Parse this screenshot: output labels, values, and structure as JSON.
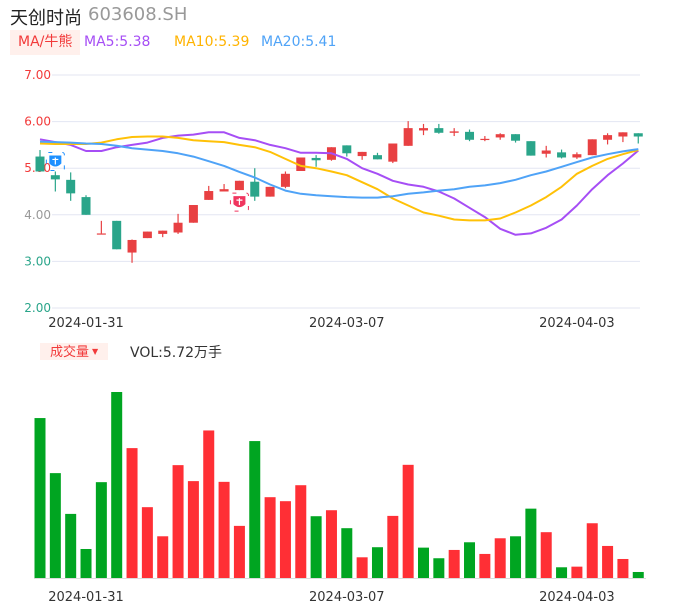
{
  "header": {
    "name": "天创时尚",
    "code": "603608.SH"
  },
  "ma_bar": {
    "toggle_label": "MA/牛熊",
    "ma5": "MA5:5.38",
    "ma10": "MA10:5.39",
    "ma20": "MA20:5.41"
  },
  "volume_bar": {
    "toggle_label": "成交量",
    "toggle_arrow": "▼",
    "vol_text": "VOL:5.72万手"
  },
  "colors": {
    "up": "#e84042",
    "down": "#2aa58a",
    "vol_up": "#ff2f35",
    "vol_down": "#00a521",
    "ma5": "#a64ef5",
    "ma10": "#ffc107",
    "ma20": "#4fa3f7",
    "grid": "#e3e6f2"
  },
  "chart_data": [
    {
      "type": "candlestick",
      "title": "天创时尚 603608.SH",
      "ylim": [
        2.0,
        7.0
      ],
      "y_ticks": [
        "7.00",
        "6.00",
        "5.00",
        "4.00",
        "3.00",
        "2.00"
      ],
      "x_ticks": [
        {
          "index": 3,
          "label": "2024-01-31"
        },
        {
          "index": 20,
          "label": "2024-03-07"
        },
        {
          "index": 35,
          "label": "2024-04-03"
        }
      ],
      "grid": true,
      "ohlc": [
        [
          5.25,
          5.39,
          4.93,
          4.93
        ],
        [
          4.85,
          4.93,
          4.5,
          4.76
        ],
        [
          4.75,
          4.91,
          4.3,
          4.46
        ],
        [
          4.38,
          4.42,
          4.0,
          4.0
        ],
        [
          3.6,
          3.87,
          3.6,
          3.6
        ],
        [
          3.87,
          3.87,
          3.26,
          3.26
        ],
        [
          3.19,
          3.47,
          2.97,
          3.46
        ],
        [
          3.5,
          3.64,
          3.5,
          3.64
        ],
        [
          3.59,
          3.66,
          3.52,
          3.66
        ],
        [
          3.62,
          4.02,
          3.59,
          3.83
        ],
        [
          3.83,
          4.21,
          3.83,
          4.21
        ],
        [
          4.32,
          4.62,
          4.32,
          4.51
        ],
        [
          4.5,
          4.66,
          4.5,
          4.55
        ],
        [
          4.53,
          4.73,
          4.53,
          4.73
        ],
        [
          4.71,
          5.0,
          4.3,
          4.39
        ],
        [
          4.39,
          4.6,
          4.39,
          4.6
        ],
        [
          4.6,
          4.93,
          4.57,
          4.88
        ],
        [
          4.94,
          5.23,
          4.94,
          5.23
        ],
        [
          5.22,
          5.28,
          5.03,
          5.17
        ],
        [
          5.18,
          5.45,
          5.16,
          5.45
        ],
        [
          5.49,
          5.49,
          5.25,
          5.32
        ],
        [
          5.26,
          5.35,
          5.18,
          5.35
        ],
        [
          5.28,
          5.33,
          5.19,
          5.19
        ],
        [
          5.14,
          5.53,
          5.11,
          5.53
        ],
        [
          5.48,
          6.01,
          5.48,
          5.86
        ],
        [
          5.81,
          5.95,
          5.71,
          5.86
        ],
        [
          5.86,
          5.95,
          5.74,
          5.76
        ],
        [
          5.76,
          5.86,
          5.69,
          5.79
        ],
        [
          5.78,
          5.83,
          5.58,
          5.61
        ],
        [
          5.61,
          5.69,
          5.58,
          5.63
        ],
        [
          5.66,
          5.75,
          5.61,
          5.73
        ],
        [
          5.73,
          5.73,
          5.55,
          5.59
        ],
        [
          5.58,
          5.58,
          5.27,
          5.27
        ],
        [
          5.31,
          5.48,
          5.23,
          5.38
        ],
        [
          5.34,
          5.4,
          5.21,
          5.23
        ],
        [
          5.23,
          5.34,
          5.2,
          5.3
        ],
        [
          5.28,
          5.62,
          5.28,
          5.62
        ],
        [
          5.61,
          5.75,
          5.51,
          5.71
        ],
        [
          5.68,
          5.77,
          5.56,
          5.77
        ],
        [
          5.75,
          5.75,
          5.53,
          5.68
        ]
      ],
      "ma5": [
        5.62,
        5.56,
        5.5,
        5.37,
        5.37,
        5.45,
        5.5,
        5.55,
        5.65,
        5.7,
        5.72,
        5.77,
        5.77,
        5.65,
        5.6,
        5.5,
        5.43,
        5.33,
        5.33,
        5.32,
        5.2,
        5.0,
        4.88,
        4.73,
        4.65,
        4.6,
        4.5,
        4.35,
        4.15,
        3.95,
        3.7,
        3.57,
        3.6,
        3.72,
        3.9,
        4.2,
        4.55,
        4.85,
        5.1,
        5.38
      ],
      "ma10": [
        5.53,
        5.52,
        5.52,
        5.52,
        5.55,
        5.62,
        5.67,
        5.68,
        5.68,
        5.65,
        5.6,
        5.58,
        5.56,
        5.5,
        5.45,
        5.35,
        5.2,
        5.05,
        5.0,
        4.93,
        4.85,
        4.7,
        4.55,
        4.35,
        4.2,
        4.05,
        3.98,
        3.9,
        3.88,
        3.88,
        3.92,
        4.05,
        4.2,
        4.38,
        4.6,
        4.88,
        5.05,
        5.2,
        5.3,
        5.39
      ],
      "ma20": [
        5.57,
        5.56,
        5.55,
        5.53,
        5.52,
        5.48,
        5.43,
        5.4,
        5.37,
        5.32,
        5.25,
        5.15,
        5.05,
        4.92,
        4.8,
        4.65,
        4.52,
        4.45,
        4.42,
        4.4,
        4.38,
        4.37,
        4.37,
        4.4,
        4.45,
        4.48,
        4.52,
        4.55,
        4.6,
        4.63,
        4.68,
        4.75,
        4.85,
        4.93,
        5.03,
        5.13,
        5.23,
        5.3,
        5.36,
        5.41
      ],
      "markers": [
        {
          "index": 1,
          "type": "bear"
        },
        {
          "index": 13,
          "type": "bull"
        }
      ]
    },
    {
      "type": "bar",
      "title": "成交量",
      "unit": "万手",
      "ylim": [
        0,
        177
      ],
      "x_ticks": [
        {
          "index": 3,
          "label": "2024-01-31"
        },
        {
          "index": 20,
          "label": "2024-03-07"
        },
        {
          "index": 35,
          "label": "2024-04-03"
        }
      ],
      "values": [
        152.2,
        99.8,
        61.0,
        27.6,
        91.2,
        177.0,
        123.6,
        67.4,
        39.7,
        107.4,
        92.2,
        140.4,
        91.5,
        49.6,
        130.3,
        76.9,
        73.1,
        88.3,
        58.8,
        64.5,
        47.4,
        19.7,
        29.3,
        59.1,
        107.7,
        28.9,
        18.8,
        26.7,
        34.0,
        22.9,
        37.8,
        39.7,
        66.0,
        43.6,
        10.2,
        10.8,
        52.1,
        30.5,
        18.1,
        5.72
      ],
      "direction": [
        "down",
        "down",
        "down",
        "down",
        "down",
        "down",
        "up",
        "up",
        "up",
        "up",
        "up",
        "up",
        "up",
        "up",
        "down",
        "up",
        "up",
        "up",
        "down",
        "up",
        "down",
        "up",
        "down",
        "up",
        "up",
        "down",
        "down",
        "up",
        "down",
        "up",
        "up",
        "down",
        "down",
        "up",
        "down",
        "up",
        "up",
        "up",
        "up",
        "down"
      ]
    }
  ]
}
